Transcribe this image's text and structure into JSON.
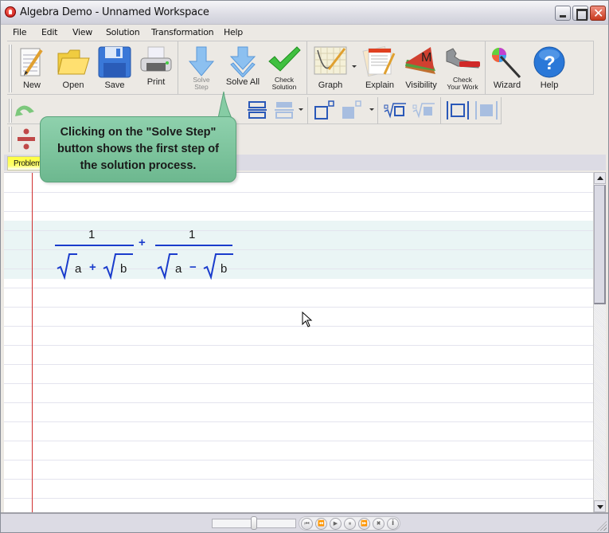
{
  "window": {
    "title": "Algebra Demo - Unnamed Workspace"
  },
  "menu": [
    "File",
    "Edit",
    "View",
    "Solution",
    "Transformation",
    "Help"
  ],
  "toolbar": {
    "file_group": [
      {
        "label": "New",
        "icon": "new-document-icon"
      },
      {
        "label": "Open",
        "icon": "folder-icon"
      },
      {
        "label": "Save",
        "icon": "floppy-disk-icon"
      },
      {
        "label": "Print",
        "icon": "printer-icon"
      }
    ],
    "solve_group": [
      {
        "label": "Solve\nStep",
        "label_line1": "Solve",
        "label_line2": "Step",
        "icon": "arrow-down-icon"
      },
      {
        "label": "Solve All",
        "icon": "double-arrow-down-icon"
      },
      {
        "label": "Check\nSolution",
        "label_line1": "Check",
        "label_line2": "Solution",
        "icon": "checkmark-icon"
      }
    ],
    "tools_group": [
      {
        "label": "Graph",
        "icon": "graph-icon"
      },
      {
        "label": "Explain",
        "icon": "explain-icon"
      },
      {
        "label": "Visibility",
        "icon": "visibility-icon",
        "glyph": "M"
      },
      {
        "label_line1": "Check",
        "label_line2": "Your Work",
        "icon": "wrench-icon"
      }
    ],
    "help_group": [
      {
        "label": "Wizard",
        "icon": "wand-icon"
      },
      {
        "label": "Help",
        "icon": "help-icon",
        "glyph": "?"
      }
    ]
  },
  "tabs": {
    "active": "Problem"
  },
  "expression": {
    "term1": {
      "numerator": "1",
      "denominator": [
        "a",
        "+",
        "b"
      ]
    },
    "operator": "+",
    "term2": {
      "numerator": "1",
      "denominator": [
        "a",
        "−",
        "b"
      ]
    }
  },
  "callout": {
    "text_line1": "Clicking on the \"Solve Step\"",
    "text_line2": "button shows the first step of",
    "text_line3": "the solution process."
  },
  "player": {
    "progress": 0.5,
    "buttons": [
      "first",
      "rewind",
      "play",
      "pause",
      "fast-forward",
      "stop",
      "info"
    ],
    "glyphs": [
      "⏮",
      "⏪",
      "▶",
      "⏸",
      "⏩",
      "✖",
      "i"
    ]
  },
  "colors": {
    "math_blue": "#1a3ccc",
    "callout_green": "#7cc59c",
    "tab_yellow": "#ffff40",
    "margin_red": "#d03030"
  }
}
